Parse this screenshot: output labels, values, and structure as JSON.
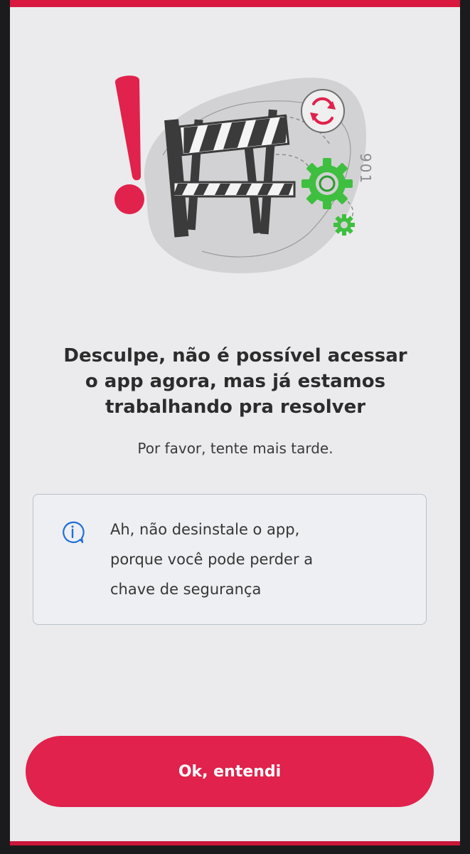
{
  "error": {
    "code": "901",
    "title_lines": [
      "Desculpe, não é possível acessar",
      "o app agora, mas já estamos",
      "trabalhando pra resolver"
    ],
    "subtitle": "Por favor, tente mais tarde."
  },
  "notice": {
    "icon": "info-icon",
    "lines": [
      "Ah, não desinstale o app,",
      "porque você pode perder a",
      "chave de segurança"
    ]
  },
  "actions": {
    "ok_label": "Ok, entendi"
  },
  "colors": {
    "brand": "#e0224c",
    "accent_green": "#3fbf3f",
    "text": "#2c2c2c"
  }
}
